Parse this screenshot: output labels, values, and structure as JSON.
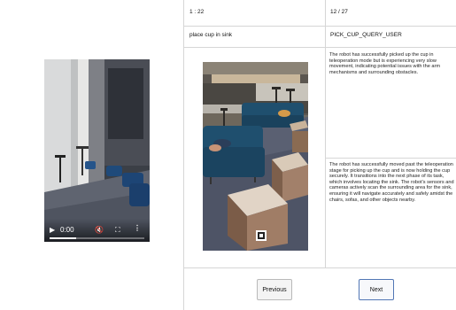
{
  "video": {
    "time": "0:00",
    "icons": {
      "play": "play-icon",
      "mute": "volume-muted-icon",
      "fullscreen": "fullscreen-icon",
      "more": "more-vertical-icon"
    },
    "progress_fraction": 0.28
  },
  "header": {
    "step_left": "1 : 22",
    "step_right": "12 / 27"
  },
  "task": {
    "instruction": "place cup in sink",
    "action": "PICK_CUP_QUERY_USER"
  },
  "descriptions": {
    "first": "The robot has successfully picked up the cup in teleoperation mode but is experiencing very slow movement, indicating potential issues with the arm mechanisms and surrounding obstacles.",
    "second": "The robot has successfully moved past the teleoperation stage for picking up the cup and is now holding the cup securely. It transitions into the next phase of its task, which involves locating the sink. The robot's sensors and cameras actively scan the surrounding area for the sink, ensuring it will navigate accurately and safely amidst the chairs, sofas, and other objects nearby."
  },
  "buttons": {
    "previous": "Previous",
    "next": "Next"
  },
  "colors": {
    "grid_line": "#d6d6d6",
    "next_border": "#5277b5",
    "sofa": "#1f4f6e"
  }
}
